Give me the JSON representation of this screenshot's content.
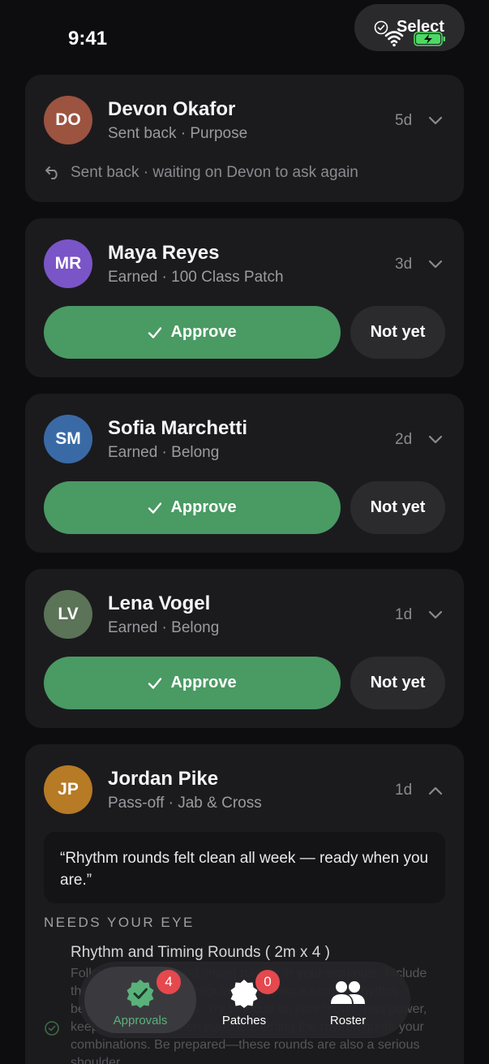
{
  "status_bar": {
    "time": "9:41"
  },
  "header": {
    "select_label": "Select"
  },
  "cards": [
    {
      "initials": "DO",
      "name": "Devon Okafor",
      "subtitle": "Sent back · Purpose",
      "age": "5d",
      "avatar_color": "#9c5340",
      "note": "Sent back · waiting on Devon to ask again"
    },
    {
      "initials": "MR",
      "name": "Maya Reyes",
      "subtitle": "Earned · 100 Class Patch",
      "age": "3d",
      "avatar_color": "#7a55c7",
      "approve_label": "Approve",
      "not_yet_label": "Not yet"
    },
    {
      "initials": "SM",
      "name": "Sofia Marchetti",
      "subtitle": "Earned · Belong",
      "age": "2d",
      "avatar_color": "#3a6aa6",
      "approve_label": "Approve",
      "not_yet_label": "Not yet"
    },
    {
      "initials": "LV",
      "name": "Lena Vogel",
      "subtitle": "Earned · Belong",
      "age": "1d",
      "avatar_color": "#5b7357",
      "approve_label": "Approve",
      "not_yet_label": "Not yet"
    },
    {
      "initials": "JP",
      "name": "Jordan Pike",
      "subtitle": "Pass-off · Jab & Cross",
      "age": "1d",
      "avatar_color": "#b77a25",
      "quote": "“Rhythm rounds felt clean all week — ready when you are.”",
      "section_title": "NEEDS YOUR EYE",
      "item_title": "Rhythm and Timing Rounds ( 2m x 4 )",
      "item_desc": "Follow the rhythm and timing rounds in your workouts. Include these in your training regularly, keeping a smooth rhythm between combinations. Try to focus on flow rather than power, keeping pace between punches, letting the rhythm guide your combinations. Be prepared—these rounds are also a serious shoulder"
    }
  ],
  "tabbar": {
    "tabs": [
      {
        "label": "Approvals",
        "badge": "4",
        "icon": "approval-badge-icon",
        "active": true
      },
      {
        "label": "Patches",
        "badge": "0",
        "icon": "patch-icon",
        "active": false
      },
      {
        "label": "Roster",
        "icon": "people-icon",
        "active": false
      }
    ]
  },
  "colors": {
    "accent": "#4a9a63",
    "background": "#0d0d0f",
    "card": "#1b1b1e",
    "badge": "#e5484d"
  }
}
